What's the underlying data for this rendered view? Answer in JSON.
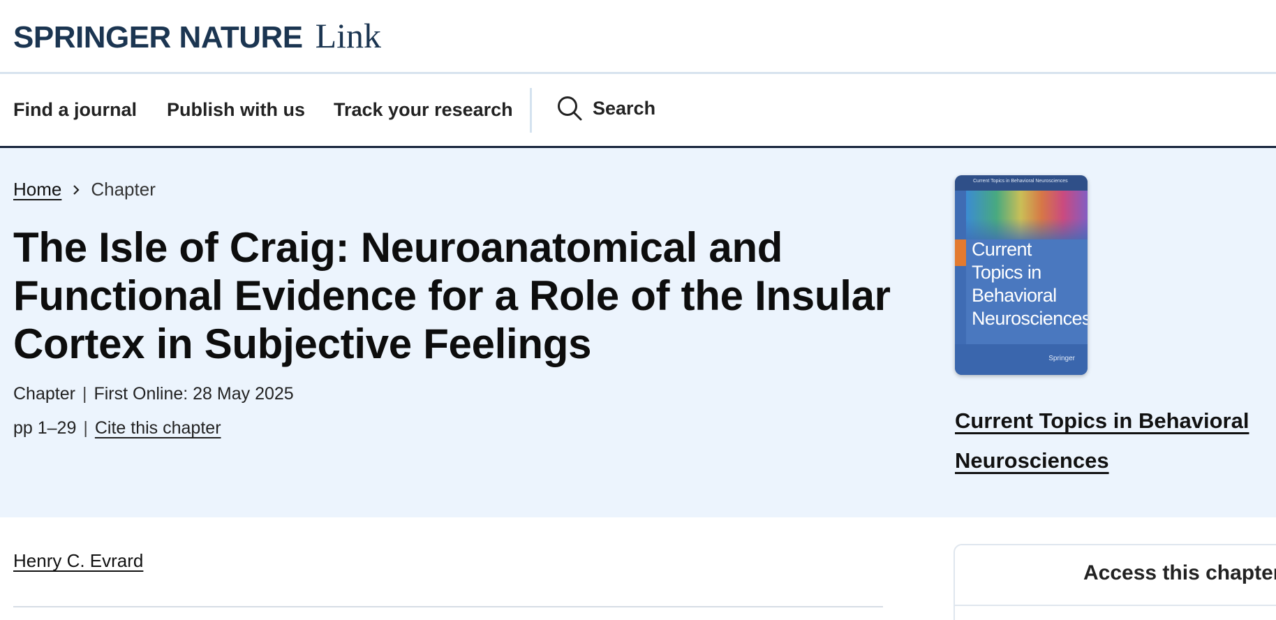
{
  "brand": {
    "springer_nature": "SPRINGER NATURE",
    "link": "Link"
  },
  "nav": {
    "items": [
      {
        "label": "Find a journal"
      },
      {
        "label": "Publish with us"
      },
      {
        "label": "Track your research"
      }
    ],
    "search_label": "Search"
  },
  "breadcrumb": {
    "home": "Home",
    "current": "Chapter"
  },
  "article": {
    "title": "The Isle of Craig: Neuroanatomical and Functional Evidence for a Role of the Insular Cortex in Subjective Feelings",
    "type": "Chapter",
    "first_online": "First Online: 28 May 2025",
    "pages": "pp 1–29",
    "cite_label": "Cite this chapter",
    "author": "Henry C. Evrard"
  },
  "book": {
    "cover_series_small": "Current Topics in Behavioral Neurosciences",
    "cover_title": "Current Topics in Behavioral Neurosciences",
    "cover_publisher": "Springer",
    "link_label": "Current Topics in Behavioral Neurosciences"
  },
  "access": {
    "title": "Access this chapter"
  },
  "colors": {
    "brand_navy": "#1b3551",
    "hero_background": "#ecf4fd",
    "nav_border": "#15233a"
  }
}
